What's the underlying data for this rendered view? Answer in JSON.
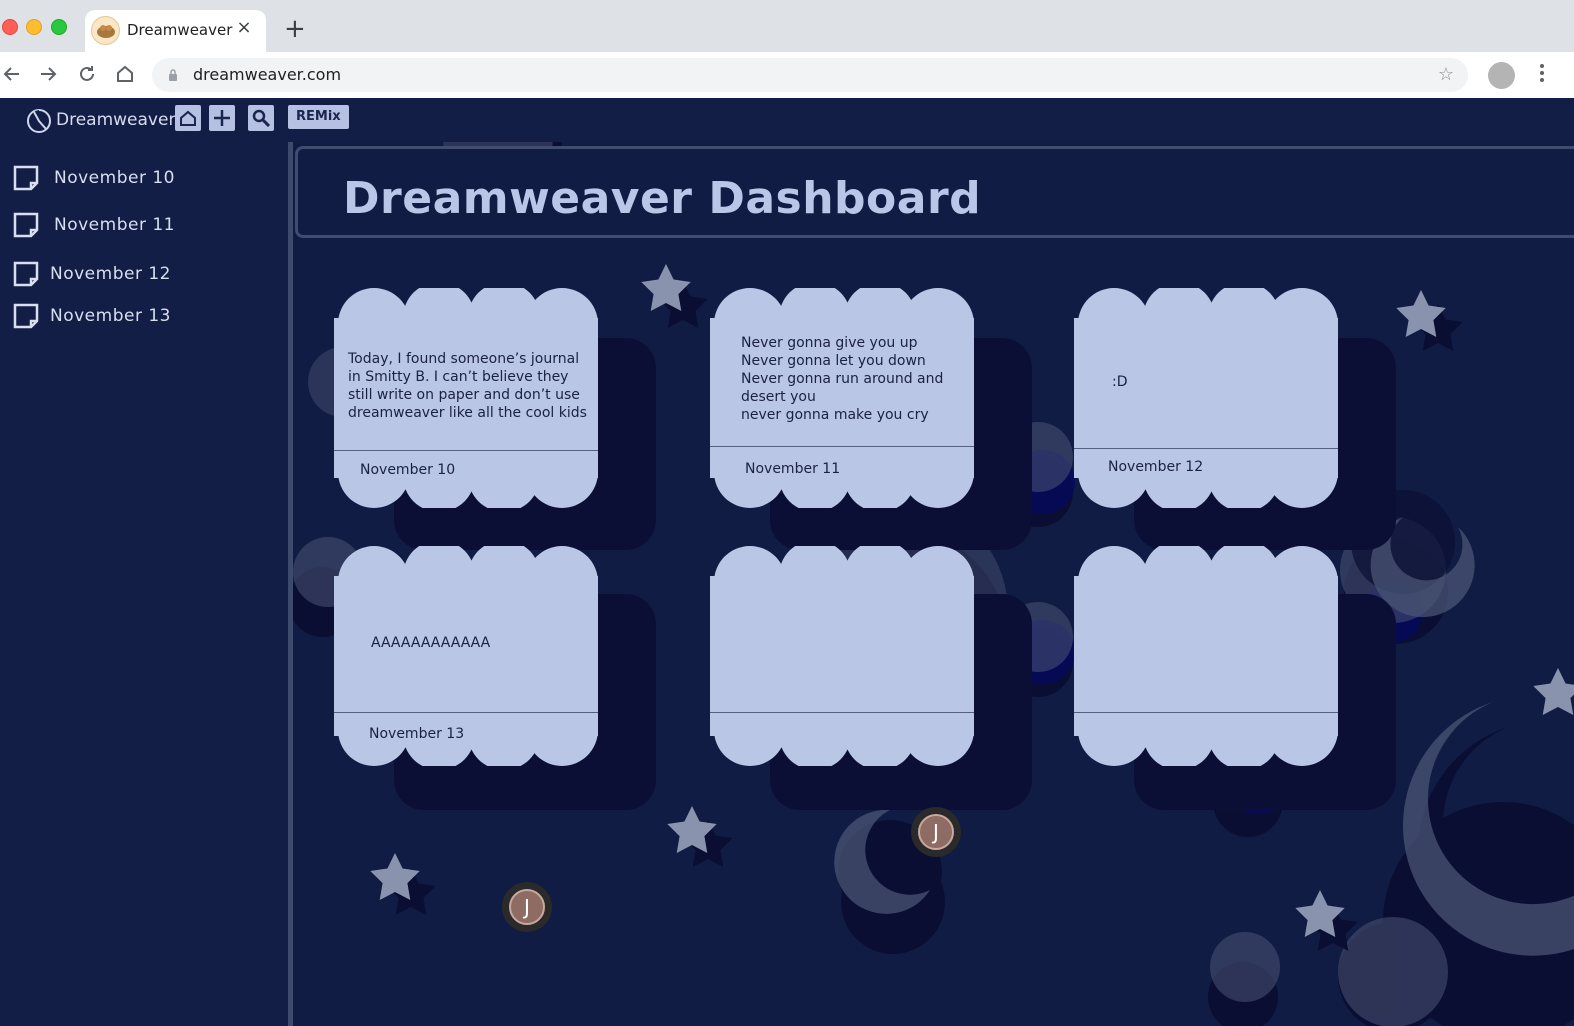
{
  "browser": {
    "tab_title": "Dreamweaver",
    "tab_close": "×",
    "new_tab": "+",
    "url": "dreamweaver.com"
  },
  "app": {
    "brand": "Dreamweaver",
    "remix_label": "REMix",
    "title": "Dreamweaver Dashboard"
  },
  "sidebar": {
    "items": [
      {
        "label": "November 10"
      },
      {
        "label": "November 11"
      },
      {
        "label": "November 12"
      },
      {
        "label": "November 13"
      }
    ]
  },
  "cards": [
    {
      "text": "Today, I found someone’s journal in Smitty B. I can’t believe they still write on paper and don’t use dreamweaver like all the cool kids",
      "date": "November 10"
    },
    {
      "text": "Never gonna give you up\nNever gonna let you down\nNever gonna run around and desert you\nnever gonna make you cry",
      "date": "November 11"
    },
    {
      "text": ":D",
      "date": "November 12"
    },
    {
      "text": "AAAAAAAAAAAA",
      "date": "November 13"
    },
    {
      "text": "",
      "date": ""
    },
    {
      "text": "",
      "date": ""
    }
  ],
  "avatars": [
    {
      "initial": "J"
    },
    {
      "initial": "J"
    }
  ],
  "colors": {
    "background": "#111c44",
    "card": "#bac6e6",
    "card_shadow": "#0b0f36",
    "accent": "#b5c0e2"
  }
}
